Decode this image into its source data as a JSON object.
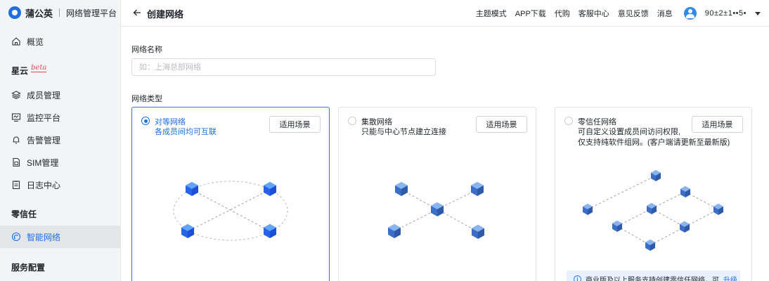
{
  "brand": {
    "name": "蒲公英",
    "subtitle": "网络管理平台"
  },
  "sidebar": {
    "items": [
      {
        "label": "概览",
        "icon": "home-icon"
      },
      {
        "label": "成员管理",
        "icon": "layers-icon"
      },
      {
        "label": "监控平台",
        "icon": "monitor-icon"
      },
      {
        "label": "告警管理",
        "icon": "bell-icon"
      },
      {
        "label": "SIM管理",
        "icon": "sim-icon"
      },
      {
        "label": "日志中心",
        "icon": "log-icon"
      },
      {
        "label": "智能网络",
        "icon": "smart-network-icon",
        "active": true
      }
    ],
    "sections": {
      "xingyun": "星云",
      "beta": "beta",
      "zero_trust": "零信任",
      "service_config": "服务配置"
    }
  },
  "header": {
    "title": "创建网络",
    "links": [
      "主题模式",
      "APP下载",
      "代购",
      "客服中心",
      "意见反馈",
      "消息"
    ],
    "username": "90±2±1••5•"
  },
  "form": {
    "name_label": "网络名称",
    "name_placeholder": "如：上海总部网络",
    "name_value": "",
    "type_label": "网络类型"
  },
  "cards": [
    {
      "title": "对等网络",
      "desc": [
        "各成员间均可互联"
      ],
      "button": "适用场景",
      "selected": true
    },
    {
      "title": "集散网络",
      "desc": [
        "只能与中心节点建立连接"
      ],
      "button": "适用场景",
      "selected": false
    },
    {
      "title": "零信任网络",
      "desc": [
        "可自定义设置成员间访问权限,",
        "仅支持纯软件组网。(客户端请更新至最新版)"
      ],
      "button": "适用场景",
      "selected": false
    }
  ],
  "notice": {
    "text": "商业版及以上服务支持创建零信任网络，可",
    "link": "升级"
  },
  "colors": {
    "accent": "#1f6fe0",
    "selected_border": "#3a7be0",
    "node": "#3b82f6"
  }
}
